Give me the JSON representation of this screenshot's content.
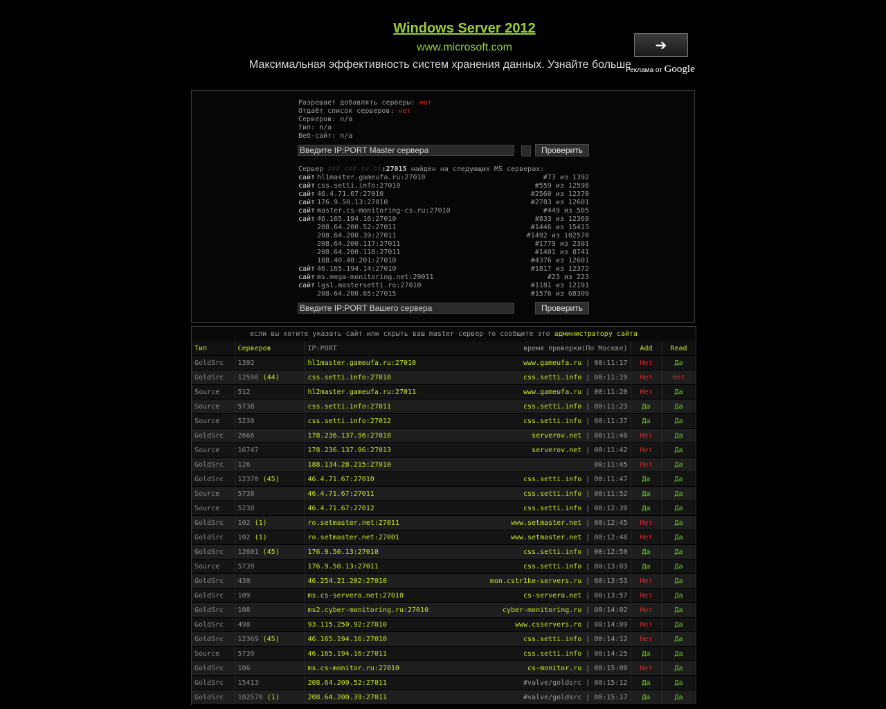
{
  "ad": {
    "title": "Windows Server 2012",
    "url": "www.microsoft.com",
    "description": "Максимальная эффективность систем хранения данных. Узнайте больше",
    "button_arrow": "➔",
    "google_label": "Реклама от",
    "google_brand": "Google"
  },
  "master_info": {
    "allows_add_label": "Разрешает добавлять серверы:",
    "allows_add_value": "нет",
    "gives_list_label": "Отдаёт список серверов:",
    "gives_list_value": "нет",
    "servers_line": "Серверов: n/a",
    "type_line": "Тип: n/a",
    "website_line": "Веб-сайт: n/a",
    "master_input_placeholder": "Введите IP:PORT Master сервера",
    "check_label": "Проверить",
    "server_input_placeholder": "Введите IP:PORT Вашего сервера"
  },
  "found": {
    "prefix": "Сервер",
    "hidden_ip": "###.###.##.##",
    "port": ":27015",
    "suffix": "найден на следующих MS серверах:",
    "rows": [
      {
        "label": "сайт",
        "addr": "hl1master.gameufa.ru:27010",
        "rank": "#73 из 1392"
      },
      {
        "label": "сайт",
        "addr": "css.setti.info:27010",
        "rank": "#559 из 12598"
      },
      {
        "label": "сайт",
        "addr": "46.4.71.67:27010",
        "rank": "#2560 из 12370"
      },
      {
        "label": "сайт",
        "addr": "176.9.50.13:27010",
        "rank": "#2783 из 12601"
      },
      {
        "label": "сайт",
        "addr": "master.cs-monitoring-cs.ru:27010",
        "rank": "#449 из 505"
      },
      {
        "label": "сайт",
        "addr": "46.165.194.16:27010",
        "rank": "#833 из 12369"
      },
      {
        "label": "",
        "addr": "208.64.200.52:27011",
        "rank": "#1446 из 15413"
      },
      {
        "label": "",
        "addr": "208.64.200.39:27011",
        "rank": "#1492 из 102570"
      },
      {
        "label": "",
        "addr": "208.64.200.117:27011",
        "rank": "#1779 из 2301"
      },
      {
        "label": "",
        "addr": "208.64.200.118:27011",
        "rank": "#1401 из 8741"
      },
      {
        "label": "",
        "addr": "188.40.40.201:27010",
        "rank": "#4376 из 12601"
      },
      {
        "label": "сайт",
        "addr": "46.165.194.14:27010",
        "rank": "#1817 из 12372"
      },
      {
        "label": "сайт",
        "addr": "ms.mega-monitoring.net:29011",
        "rank": "#23 из 223"
      },
      {
        "label": "сайт",
        "addr": "lgsl.mastersetti.ro:27010",
        "rank": "#1181 из 12191"
      },
      {
        "label": "",
        "addr": "208.64.200.65:27015",
        "rank": "#1576 из 68309"
      }
    ]
  },
  "notice": {
    "text": "если вы хотите указать сайт или скрыть ваш master сервер то сообщите это",
    "link": "администратору сайта"
  },
  "table": {
    "headers": {
      "type": "Тип",
      "servers": "Серверов",
      "ipport": "IP:PORT",
      "time": "время проверки(По Москве)",
      "add": "Add",
      "read": "Read"
    },
    "rows": [
      {
        "type": "GoldSrc",
        "count": "1392",
        "extra": "",
        "ip": "hl1master.gameufa.ru:27010",
        "site": "www.gameufa.ru",
        "time": "00:11:17",
        "add": "Нет",
        "read": "Да"
      },
      {
        "type": "GoldSrc",
        "count": "12598",
        "extra": "(44)",
        "ip": "css.setti.info:27010",
        "site": "css.setti.info",
        "time": "00:11:19",
        "add": "Нет",
        "read": "Нет"
      },
      {
        "type": "Source",
        "count": "512",
        "extra": "",
        "ip": "hl2master.gameufa.ru:27011",
        "site": "www.gameufa.ru",
        "time": "00:11:20",
        "add": "Нет",
        "read": "Да"
      },
      {
        "type": "Source",
        "count": "5738",
        "extra": "",
        "ip": "css.setti.info:27011",
        "site": "css.setti.info",
        "time": "00:11:23",
        "add": "Да",
        "read": "Да"
      },
      {
        "type": "Source",
        "count": "5230",
        "extra": "",
        "ip": "css.setti.info:27012",
        "site": "css.setti.info",
        "time": "00:11:37",
        "add": "Да",
        "read": "Да"
      },
      {
        "type": "GoldSrc",
        "count": "2666",
        "extra": "",
        "ip": "178.236.137.96:27010",
        "site": "serverov.net",
        "time": "00:11:40",
        "add": "Нет",
        "read": "Да"
      },
      {
        "type": "Source",
        "count": "16747",
        "extra": "",
        "ip": "178.236.137.96:27013",
        "site": "serverov.net",
        "time": "00:11:42",
        "add": "Нет",
        "read": "Да"
      },
      {
        "type": "GoldSrc",
        "count": "126",
        "extra": "",
        "ip": "188.134.28.215:27010",
        "site": "",
        "time": "00:11:45",
        "add": "Нет",
        "read": "Да"
      },
      {
        "type": "GoldSrc",
        "count": "12370",
        "extra": "(45)",
        "ip": "46.4.71.67:27010",
        "site": "css.setti.info",
        "time": "00:11:47",
        "add": "Да",
        "read": "Да"
      },
      {
        "type": "Source",
        "count": "5738",
        "extra": "",
        "ip": "46.4.71.67:27011",
        "site": "css.setti.info",
        "time": "00:11:52",
        "add": "Да",
        "read": "Да"
      },
      {
        "type": "Source",
        "count": "5230",
        "extra": "",
        "ip": "46.4.71.67:27012",
        "site": "css.setti.info",
        "time": "00:12:39",
        "add": "Да",
        "read": "Да"
      },
      {
        "type": "GoldSrc",
        "count": "102",
        "extra": "(1)",
        "ip": "ro.setmaster.net:27011",
        "site": "www.setmaster.net",
        "time": "00:12:45",
        "add": "Нет",
        "read": "Да"
      },
      {
        "type": "GoldSrc",
        "count": "102",
        "extra": "(1)",
        "ip": "ro.setmaster.net:27001",
        "site": "www.setmaster.net",
        "time": "00:12:48",
        "add": "Нет",
        "read": "Да"
      },
      {
        "type": "GoldSrc",
        "count": "12601",
        "extra": "(45)",
        "ip": "176.9.50.13:27010",
        "site": "css.setti.info",
        "time": "00:12:50",
        "add": "Да",
        "read": "Да"
      },
      {
        "type": "Source",
        "count": "5739",
        "extra": "",
        "ip": "176.9.50.13:27011",
        "site": "css.setti.info",
        "time": "00:13:03",
        "add": "Да",
        "read": "Да"
      },
      {
        "type": "GoldSrc",
        "count": "430",
        "extra": "",
        "ip": "46.254.21.202:27010",
        "site": "mon.cstr1ke-servers.ru",
        "time": "00:13:53",
        "add": "Нет",
        "read": "Да"
      },
      {
        "type": "GoldSrc",
        "count": "109",
        "extra": "",
        "ip": "ms.cs-servera.net:27010",
        "site": "cs-servera.net",
        "time": "00:13:57",
        "add": "Нет",
        "read": "Да"
      },
      {
        "type": "GoldSrc",
        "count": "108",
        "extra": "",
        "ip": "ms2.cyber-monitoring.ru:27010",
        "site": "cyber-monitoring.ru",
        "time": "00:14:02",
        "add": "Нет",
        "read": "Да"
      },
      {
        "type": "GoldSrc",
        "count": "498",
        "extra": "",
        "ip": "93.115.250.92:27010",
        "site": "www.csservers.ro",
        "time": "00:14:09",
        "add": "Нет",
        "read": "Да"
      },
      {
        "type": "GoldSrc",
        "count": "12369",
        "extra": "(45)",
        "ip": "46.165.194.16:27010",
        "site": "css.setti.info",
        "time": "00:14:12",
        "add": "Нет",
        "read": "Да"
      },
      {
        "type": "Source",
        "count": "5739",
        "extra": "",
        "ip": "46.165.194.16:27011",
        "site": "css.setti.info",
        "time": "00:14:25",
        "add": "Да",
        "read": "Да"
      },
      {
        "type": "GoldSrc",
        "count": "106",
        "extra": "",
        "ip": "ms.cs-monitor.ru:27010",
        "site": "cs-monitor.ru",
        "time": "00:15:09",
        "add": "Нет",
        "read": "Да"
      },
      {
        "type": "GoldSrc",
        "count": "15413",
        "extra": "",
        "ip": "208.64.200.52:27011",
        "site": "#valve/goldsrc",
        "time": "00:15:12",
        "add": "Да",
        "read": "Да"
      },
      {
        "type": "GoldSrc",
        "count": "102570",
        "extra": "(1)",
        "ip": "208.64.200.39:27011",
        "site": "#valve/goldsrc",
        "time": "00:15:17",
        "add": "Да",
        "read": "Да"
      }
    ]
  },
  "colors": {
    "accent": "#c8e620",
    "yes": "#66cc22",
    "no": "#e02020",
    "background": "#000000"
  }
}
